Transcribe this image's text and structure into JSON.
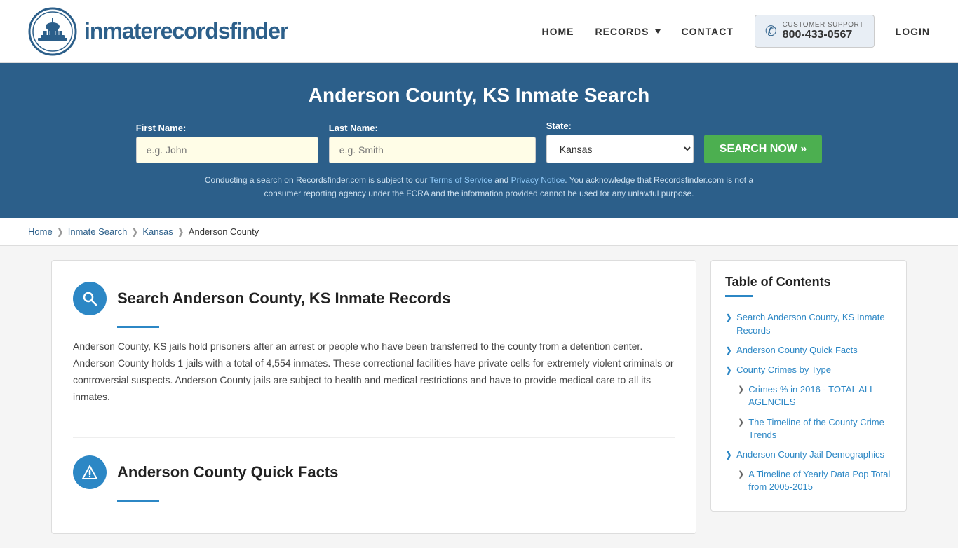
{
  "site": {
    "logo_text_normal": "inmaterecords",
    "logo_text_bold": "finder"
  },
  "nav": {
    "home_label": "HOME",
    "records_label": "RECORDS",
    "contact_label": "CONTACT",
    "support_label": "CUSTOMER SUPPORT",
    "support_number": "800-433-0567",
    "login_label": "LOGIN"
  },
  "search_banner": {
    "title": "Anderson County, KS Inmate Search",
    "first_name_label": "First Name:",
    "first_name_placeholder": "e.g. John",
    "last_name_label": "Last Name:",
    "last_name_placeholder": "e.g. Smith",
    "state_label": "State:",
    "state_value": "Kansas",
    "search_button": "SEARCH NOW »",
    "disclaimer": "Conducting a search on Recordsfinder.com is subject to our Terms of Service and Privacy Notice. You acknowledge that Recordsfinder.com is not a consumer reporting agency under the FCRA and the information provided cannot be used for any unlawful purpose.",
    "tos_label": "Terms of Service",
    "privacy_label": "Privacy Notice"
  },
  "breadcrumb": {
    "home": "Home",
    "inmate_search": "Inmate Search",
    "state": "Kansas",
    "county": "Anderson County"
  },
  "main_section": {
    "title": "Search Anderson County, KS Inmate Records",
    "body": "Anderson County, KS jails hold prisoners after an arrest or people who have been transferred to the county from a detention center. Anderson County holds 1 jails with a total of 4,554 inmates. These correctional facilities have private cells for extremely violent criminals or controversial suspects. Anderson County jails are subject to health and medical restrictions and have to provide medical care to all its inmates."
  },
  "quick_facts_section": {
    "title": "Anderson County Quick Facts"
  },
  "toc": {
    "title": "Table of Contents",
    "items": [
      {
        "label": "Search Anderson County, KS Inmate Records",
        "sub": false
      },
      {
        "label": "Anderson County Quick Facts",
        "sub": false
      },
      {
        "label": "County Crimes by Type",
        "sub": false
      },
      {
        "label": "Crimes % in 2016 - TOTAL ALL AGENCIES",
        "sub": true
      },
      {
        "label": "The Timeline of the County Crime Trends",
        "sub": true
      },
      {
        "label": "Anderson County Jail Demographics",
        "sub": false
      },
      {
        "label": "A Timeline of Yearly Data Pop Total from 2005-2015",
        "sub": true
      }
    ]
  }
}
